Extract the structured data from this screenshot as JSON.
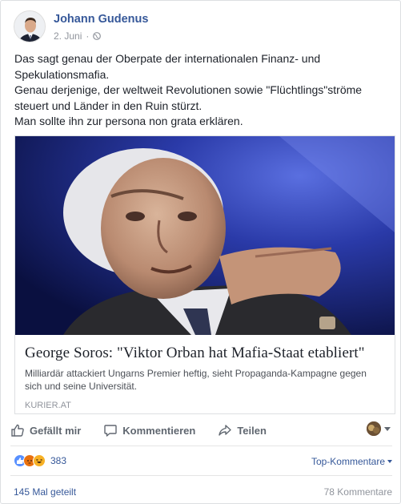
{
  "post": {
    "author": "Johann Gudenus",
    "date": "2. Juni",
    "privacy_icon": "globe-icon",
    "text_lines": [
      "Das sagt genau der Oberpate der internationalen Finanz- und Spekulationsmafia.",
      "Genau derjenige, der weltweit Revolutionen sowie \"Flüchtlings\"ströme steuert und Länder in den Ruin stürzt.",
      "Man sollte ihn zur persona non grata erklären."
    ]
  },
  "link": {
    "title": "George Soros: \"Viktor Orban hat Mafia-Staat etabliert\"",
    "description": "Milliardär attackiert Ungarns Premier heftig, sieht Propaganda-Kampagne gegen sich und seine Universität.",
    "domain": "KURIER.AT"
  },
  "actions": {
    "like": "Gefällt mir",
    "comment": "Kommentieren",
    "share": "Teilen"
  },
  "stats": {
    "reaction_count": "383",
    "top_comments": "Top-Kommentare",
    "shares": "145 Mal geteilt",
    "comments": "78 Kommentare"
  },
  "colors": {
    "link_blue": "#365899",
    "like_blue": "#5890ff",
    "angry_orange": "#e9710f",
    "haha_yellow": "#f7b125"
  }
}
